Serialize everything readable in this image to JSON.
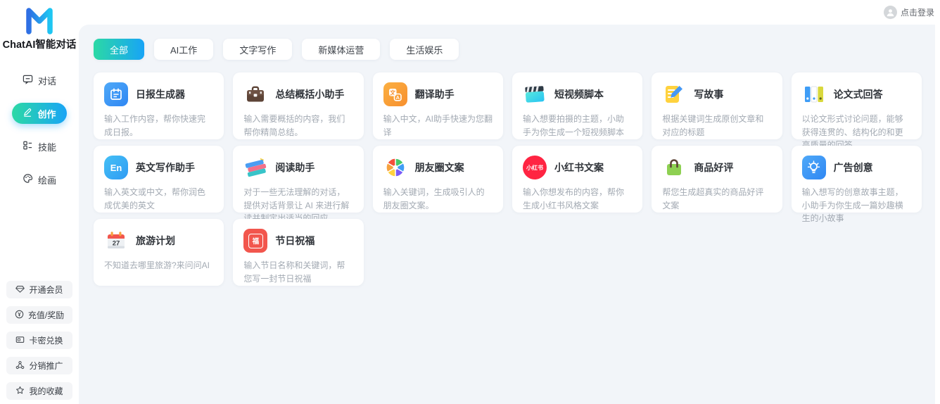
{
  "brand": {
    "name": "ChatAI智能对话",
    "logo_icon": "chatai-m-logo"
  },
  "topbar": {
    "login_label": "点击登录",
    "avatar_icon": "user-avatar-icon"
  },
  "sidebar": {
    "nav": [
      {
        "label": "对话",
        "icon": "chat-bubble-icon",
        "active": false
      },
      {
        "label": "创作",
        "icon": "pencil-icon",
        "active": true
      },
      {
        "label": "技能",
        "icon": "skills-grid-icon",
        "active": false
      },
      {
        "label": "绘画",
        "icon": "palette-icon",
        "active": false
      }
    ],
    "footer": [
      {
        "label": "开通会员",
        "icon": "gem-icon"
      },
      {
        "label": "充值/奖励",
        "icon": "coin-yuan-icon"
      },
      {
        "label": "卡密兑换",
        "icon": "card-icon"
      },
      {
        "label": "分销推广",
        "icon": "share-network-icon"
      },
      {
        "label": "我的收藏",
        "icon": "star-icon"
      }
    ]
  },
  "tabs": [
    {
      "label": "全部",
      "active": true
    },
    {
      "label": "AI工作",
      "active": false
    },
    {
      "label": "文字写作",
      "active": false
    },
    {
      "label": "新媒体运营",
      "active": false
    },
    {
      "label": "生活娱乐",
      "active": false
    }
  ],
  "cards": [
    {
      "title": "日报生成器",
      "desc": "输入工作内容，帮你快速完成日报。",
      "icon": "daily-report-clipboard-icon"
    },
    {
      "title": "总结概括小助手",
      "desc": "输入需要概括的内容，我们帮你精简总结。",
      "icon": "briefcase-icon"
    },
    {
      "title": "翻译助手",
      "desc": "输入中文，AI助手快速为您翻译",
      "icon": "translate-icon",
      "icon_text_a": "文",
      "icon_text_b": "A"
    },
    {
      "title": "短视频脚本",
      "desc": "输入想要拍摄的主题，小助手为你生成一个短视频脚本",
      "icon": "clapperboard-icon"
    },
    {
      "title": "写故事",
      "desc": "根据关键词生成原创文章和对应的标题",
      "icon": "document-pencil-icon"
    },
    {
      "title": "论文式回答",
      "desc": "以论文形式讨论问题，能够获得连贯的、结构化的和更高质量的回答。",
      "icon": "binders-icon"
    },
    {
      "title": "英文写作助手",
      "desc": "输入英文或中文，帮你润色成优美的英文",
      "icon": "english-badge-icon",
      "icon_text": "En"
    },
    {
      "title": "阅读助手",
      "desc": "对于一些无法理解的对话，提供对话背景让 AI 来进行解读并制定出适当的回应。",
      "icon": "stacked-books-icon"
    },
    {
      "title": "朋友圈文案",
      "desc": "输入关键词，生成吸引人的朋友圈文案。",
      "icon": "moments-pinwheel-icon"
    },
    {
      "title": "小红书文案",
      "desc": "输入你想发布的内容，帮你生成小红书风格文案",
      "icon": "xiaohongshu-icon",
      "icon_text": "小红书"
    },
    {
      "title": "商品好评",
      "desc": "帮您生成超真实的商品好评文案",
      "icon": "shopping-bag-icon"
    },
    {
      "title": "广告创意",
      "desc": "输入想写的创意故事主题，小助手为你生成一篇妙趣横生的小故事",
      "icon": "lightbulb-icon"
    },
    {
      "title": "旅游计划",
      "desc": "不知道去哪里旅游?来问问AI",
      "icon": "calendar-27-icon",
      "icon_text": "27"
    },
    {
      "title": "节日祝福",
      "desc": "输入节日名称和关键词，帮您写一封节日祝福",
      "icon": "festival-fu-icon",
      "icon_text": "福"
    }
  ],
  "colors": {
    "accent_gradient_start": "#2bd9a5",
    "accent_gradient_end": "#18a4f6",
    "panel_background": "#f2f5f9",
    "xiaohongshu_red": "#ff2442",
    "festival_red": "#f2564d"
  }
}
